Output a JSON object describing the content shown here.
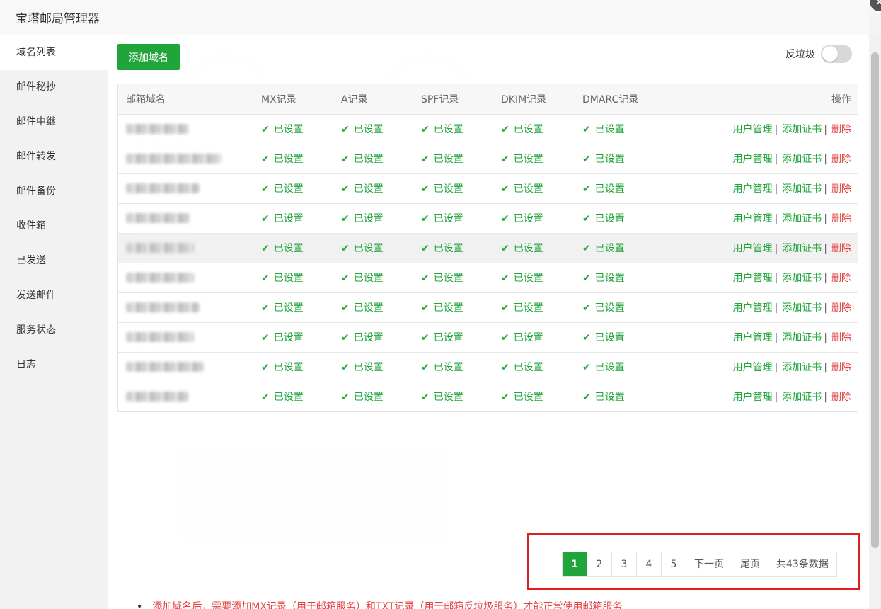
{
  "window": {
    "title": "宝塔邮局管理器"
  },
  "sidebar": {
    "items": [
      {
        "label": "域名列表",
        "active": true
      },
      {
        "label": "邮件秘抄"
      },
      {
        "label": "邮件中继"
      },
      {
        "label": "邮件转发"
      },
      {
        "label": "邮件备份"
      },
      {
        "label": "收件箱"
      },
      {
        "label": "已发送"
      },
      {
        "label": "发送邮件"
      },
      {
        "label": "服务状态"
      },
      {
        "label": "日志"
      }
    ]
  },
  "toolbar": {
    "add_domain_label": "添加域名",
    "spam_label": "反垃圾",
    "spam_enabled": false
  },
  "table": {
    "headers": {
      "domain": "邮箱域名",
      "mx": "MX记录",
      "a": "A记录",
      "spf": "SPF记录",
      "dkim": "DKIM记录",
      "dmarc": "DMARC记录",
      "op": "操作"
    },
    "status_text": "已设置",
    "actions": {
      "users": "用户管理",
      "cert": "添加证书",
      "delete": "删除"
    },
    "row_count": 10
  },
  "pagination": {
    "pages": [
      "1",
      "2",
      "3",
      "4",
      "5"
    ],
    "current": "1",
    "next": "下一页",
    "last": "尾页",
    "total": "共43条数据"
  },
  "note": "添加域名后，需要添加MX记录（用于邮箱服务）和TXT记录（用于邮箱反垃圾服务）才能正常使用邮箱服务",
  "colors": {
    "accent": "#20a53a",
    "danger": "#e43e3e",
    "highlight": "#e02020"
  }
}
